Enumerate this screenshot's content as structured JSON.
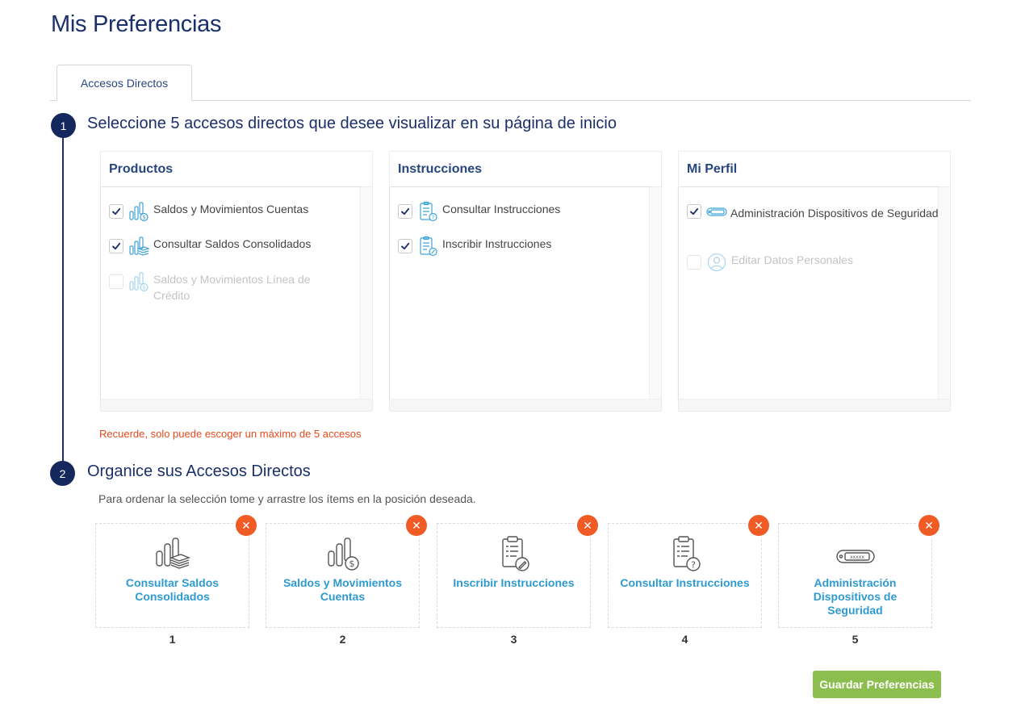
{
  "page": {
    "title": "Mis Preferencias"
  },
  "tabs": [
    {
      "label": "Accesos Directos"
    }
  ],
  "step1": {
    "number": "1",
    "title": "Seleccione 5 accesos directos que desee visualizar en su página de inicio",
    "panels": [
      {
        "title": "Productos",
        "options": [
          {
            "label": "Saldos y Movimientos Cuentas",
            "checked": true,
            "disabled": false,
            "icon": "bar-chart-dollar-icon"
          },
          {
            "label": "Consultar Saldos Consolidados",
            "checked": true,
            "disabled": false,
            "icon": "bar-chart-stack-icon"
          },
          {
            "label": "Saldos y Movimientos Línea de Crédito",
            "checked": false,
            "disabled": true,
            "icon": "bar-chart-dollar-icon"
          }
        ]
      },
      {
        "title": "Instrucciones",
        "options": [
          {
            "label": "Consultar Instrucciones",
            "checked": true,
            "disabled": false,
            "icon": "clipboard-question-icon"
          },
          {
            "label": "Inscribir Instrucciones",
            "checked": true,
            "disabled": false,
            "icon": "clipboard-pencil-icon"
          }
        ]
      },
      {
        "title": "Mi Perfil",
        "options": [
          {
            "label": "Administración Dispositivos de Seguridad",
            "checked": true,
            "disabled": false,
            "icon": "security-token-icon"
          },
          {
            "label": "Editar Datos Personales",
            "checked": false,
            "disabled": true,
            "icon": "user-profile-icon"
          }
        ]
      }
    ],
    "reminder": "Recuerde, solo puede escoger un máximo de 5 accesos"
  },
  "step2": {
    "number": "2",
    "title": "Organice sus Accesos Directos",
    "instruction": "Para ordenar la selección tome y arrastre los ítems en la posición deseada.",
    "cards": [
      {
        "label": "Consultar Saldos Consolidados",
        "position": "1",
        "icon": "bar-chart-stack-icon"
      },
      {
        "label": "Saldos y Movimientos Cuentas",
        "position": "2",
        "icon": "bar-chart-dollar-icon"
      },
      {
        "label": "Inscribir Instrucciones",
        "position": "3",
        "icon": "clipboard-pencil-icon"
      },
      {
        "label": "Consultar Instrucciones",
        "position": "4",
        "icon": "clipboard-question-icon"
      },
      {
        "label": "Administración Dispositivos de Seguridad",
        "position": "5",
        "icon": "security-token-icon"
      }
    ],
    "remove_glyph": "✕"
  },
  "actions": {
    "save_label": "Guardar Preferencias"
  },
  "colors": {
    "primary_navy": "#1b2f6b",
    "link_blue": "#2e9bd0",
    "warning_orange": "#e8491d",
    "remove_orange": "#f05a24",
    "save_green": "#8bbe4f"
  }
}
